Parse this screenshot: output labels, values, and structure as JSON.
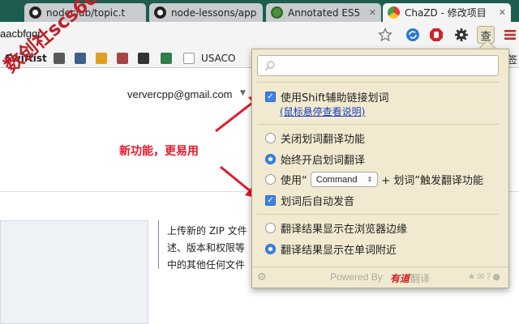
{
  "browser": {
    "tabs": [
      {
        "title": "nodeclub/topic.t",
        "icon": "github-icon"
      },
      {
        "title": "node-lessons/app",
        "icon": "github-icon"
      },
      {
        "title": "Annotated ES5",
        "icon": "es5-icon"
      },
      {
        "title": "ChaZD - 修改项目",
        "icon": "chrome-store-icon"
      }
    ],
    "close_glyph": "✕",
    "url": "aacbfggp",
    "bookmarks": [
      "Swiftist",
      "USACO"
    ],
    "bookmark_overflow": "签"
  },
  "page": {
    "email": "ververcpp@gmail.com",
    "upload_text": [
      "上传新的 ZIP 文件",
      "述、版本和权限等",
      "中的其他任何文件"
    ]
  },
  "annotation": {
    "watermark": "数创社scs66",
    "note": "新功能，更易用"
  },
  "popup": {
    "search_placeholder": "",
    "option_shift": "使用Shift辅助链接划词",
    "option_shift_link": "(鼠标悬停查看说明)",
    "option_close": "关闭划词翻译功能",
    "option_always": "始终开启划词翻译",
    "option_key_prefix": "使用“",
    "option_key_select": "Command",
    "option_key_suffix": "+ 划词”触发翻译功能",
    "option_autospeak": "划词后自动发音",
    "option_edge": "翻译结果显示在浏览器边缘",
    "option_near": "翻译结果显示在单词附近",
    "powered_by": "Powered By",
    "youdao_logo": "有道",
    "fanyi": "翻译",
    "selected_mode": "option_always",
    "selected_position": "option_near"
  },
  "colors": {
    "accent": "#3b83e7",
    "annotation_red": "#e4182a",
    "popup_bg": "#f1ead0",
    "tabstrip_bg": "#1d5c4f"
  }
}
